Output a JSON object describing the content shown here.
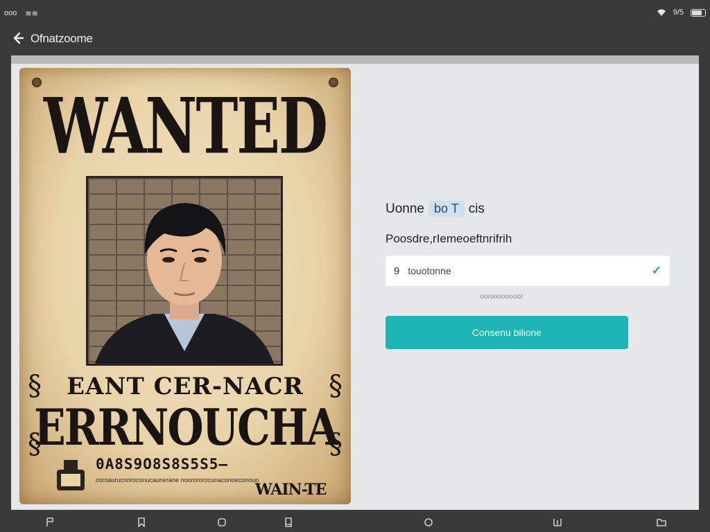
{
  "status_bar": {
    "time": "ooo",
    "left_extra": "≋≋",
    "right_text": "9/5",
    "battery_level": 0.8
  },
  "header": {
    "title": "Ofnatzoome"
  },
  "poster": {
    "title": "WANTED",
    "subtitle": "EANT CER-NACR",
    "name": "ERRNOUCHA",
    "digits": "0A8S9O8S8S5S5—",
    "small_text": "coroaurucnriroconucaunerane noorororocunaconoeconouo",
    "footer": "WAIN-TE"
  },
  "form": {
    "title_part1": "Uonne",
    "title_chip": "bo T",
    "title_part2": "cis",
    "label": "Poosdre,rIemeoeftnrifrih",
    "input_lead": "9",
    "input_value": "touotonne",
    "hint": "ooroooooooor",
    "button_label": "Consenu bilione"
  },
  "colors": {
    "accent": "#1eb3b5",
    "check": "#1aa8b0"
  }
}
